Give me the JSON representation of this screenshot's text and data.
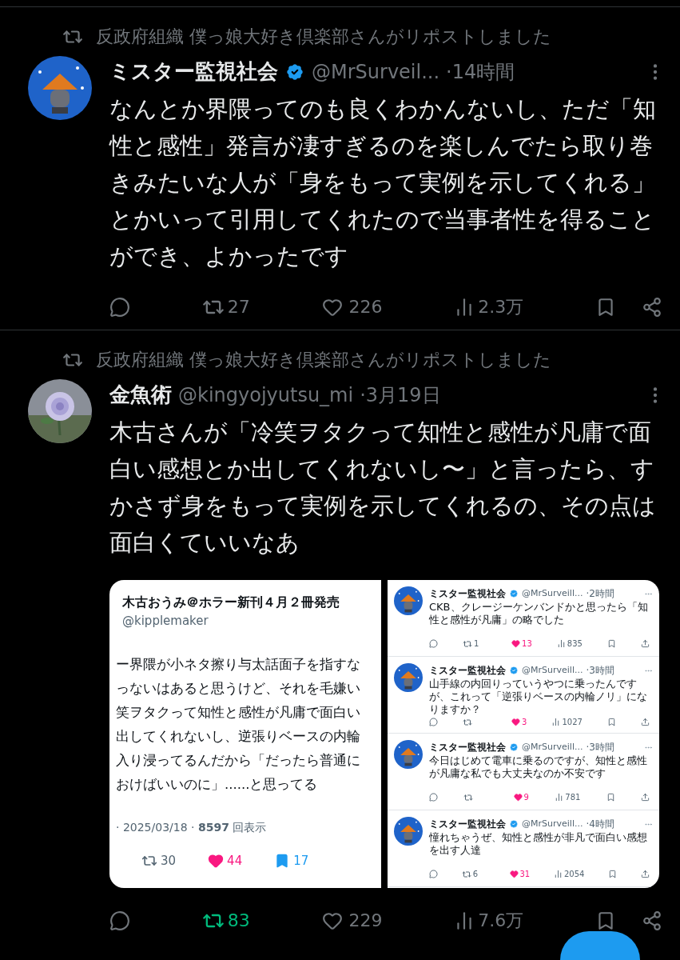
{
  "posts": [
    {
      "repost_banner": "反政府組織 僕っ娘大好き倶楽部さんがリポストしました",
      "name": "ミスター監視社会",
      "verified": true,
      "handle": "@MrSurveil...",
      "time": "·14時間",
      "text": "なんとか界隈ってのも良くわかんないし、ただ「知性と感性」発言が凄すぎるのを楽しんでたら取り巻きみたいな人が「身をもって実例を示してくれる」とかいって引用してくれたので当事者性を得ることができ、よかったです",
      "reposts": "27",
      "reposted": false,
      "likes": "226",
      "liked": false,
      "views": "2.3万"
    },
    {
      "repost_banner": "反政府組織 僕っ娘大好き倶楽部さんがリポストしました",
      "name": "金魚術",
      "verified": false,
      "handle": "@kingyojyutsu_mi",
      "time": "·3月19日",
      "text": "木古さんが「冷笑ヲタクって知性と感性が凡庸で面白い感想とか出してくれないし〜」と言ったら、すかさず身をもって実例を示してくれるの、その点は面白くていいなあ",
      "reposts": "83",
      "reposted": true,
      "likes": "229",
      "liked": false,
      "views": "7.6万",
      "media": {
        "quoted_screenshot": {
          "name": "木古おうみ＠ホラー新刊４月２冊発売",
          "handle": "@kipplemaker",
          "lines": [
            "ー界隈が小ネタ擦り与太話面子を指すな",
            "っないはあると思うけど、それを毛嫌い",
            "笑ヲタクって知性と感性が凡庸で面白い",
            "出してくれないし、逆張りベースの内輪",
            "入り浸ってるんだから「だったら普通に",
            "おけばいいのに」......と思ってる"
          ],
          "meta": "· 2025/03/18 · **8597** 回表示",
          "reposts": "30",
          "likes": "44",
          "liked": true,
          "bookmarks": "17",
          "bookmarked": true
        },
        "thread_screenshot": {
          "posts": [
            {
              "name": "ミスター監視社会",
              "handle": "@MrSurveill...",
              "time": "·2時間",
              "text": "CKB、クレージーケンバンドかと思ったら「知性と感性が凡庸」の略でした",
              "reposts": "1",
              "likes": "13",
              "views": "835"
            },
            {
              "name": "ミスター監視社会",
              "handle": "@MrSurveill...",
              "time": "·3時間",
              "text": "山手線の内回りっていうやつに乗ったんですが、これって「逆張りベースの内輪ノリ」になりますか？",
              "likes": "3",
              "views": "1027"
            },
            {
              "name": "ミスター監視社会",
              "handle": "@MrSurveill...",
              "time": "·3時間",
              "text": "今日はじめて電車に乗るのですが、知性と感性が凡庸な私でも大丈夫なのか不安です",
              "likes": "9",
              "views": "781"
            },
            {
              "name": "ミスター監視社会",
              "handle": "@MrSurveill...",
              "time": "·4時間",
              "text": "憧れちゃうぜ、知性と感性が非凡で面白い感想を出す人達",
              "reposts": "6",
              "likes": "31",
              "views": "2054"
            }
          ]
        }
      }
    }
  ]
}
